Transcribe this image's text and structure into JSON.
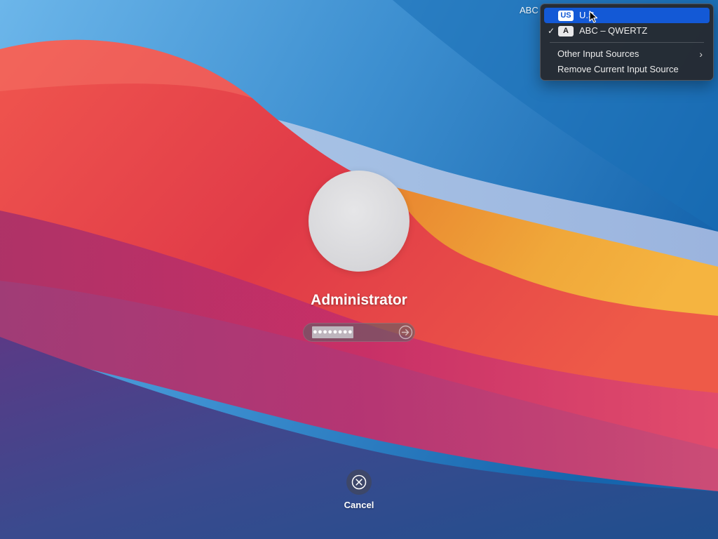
{
  "menubar": {
    "input_indicator": "ABC"
  },
  "input_menu": {
    "items": [
      {
        "badge": "US",
        "label": "U.S.",
        "checked": false,
        "highlighted": true
      },
      {
        "badge": "A",
        "label": "ABC – QWERTZ",
        "checked": true,
        "highlighted": false
      }
    ],
    "check_glyph": "✓",
    "other_sources_label": "Other Input Sources",
    "remove_source_label": "Remove Current Input Source",
    "submenu_glyph": "›"
  },
  "login": {
    "username": "Administrator",
    "password_mask": "●●●●●●●●",
    "submit_icon": "arrow-right-circle-icon",
    "cancel_label": "Cancel",
    "cancel_icon": "close-circle-icon"
  },
  "colors": {
    "menu_highlight": "#1359d6",
    "menu_background": "#26282e"
  }
}
